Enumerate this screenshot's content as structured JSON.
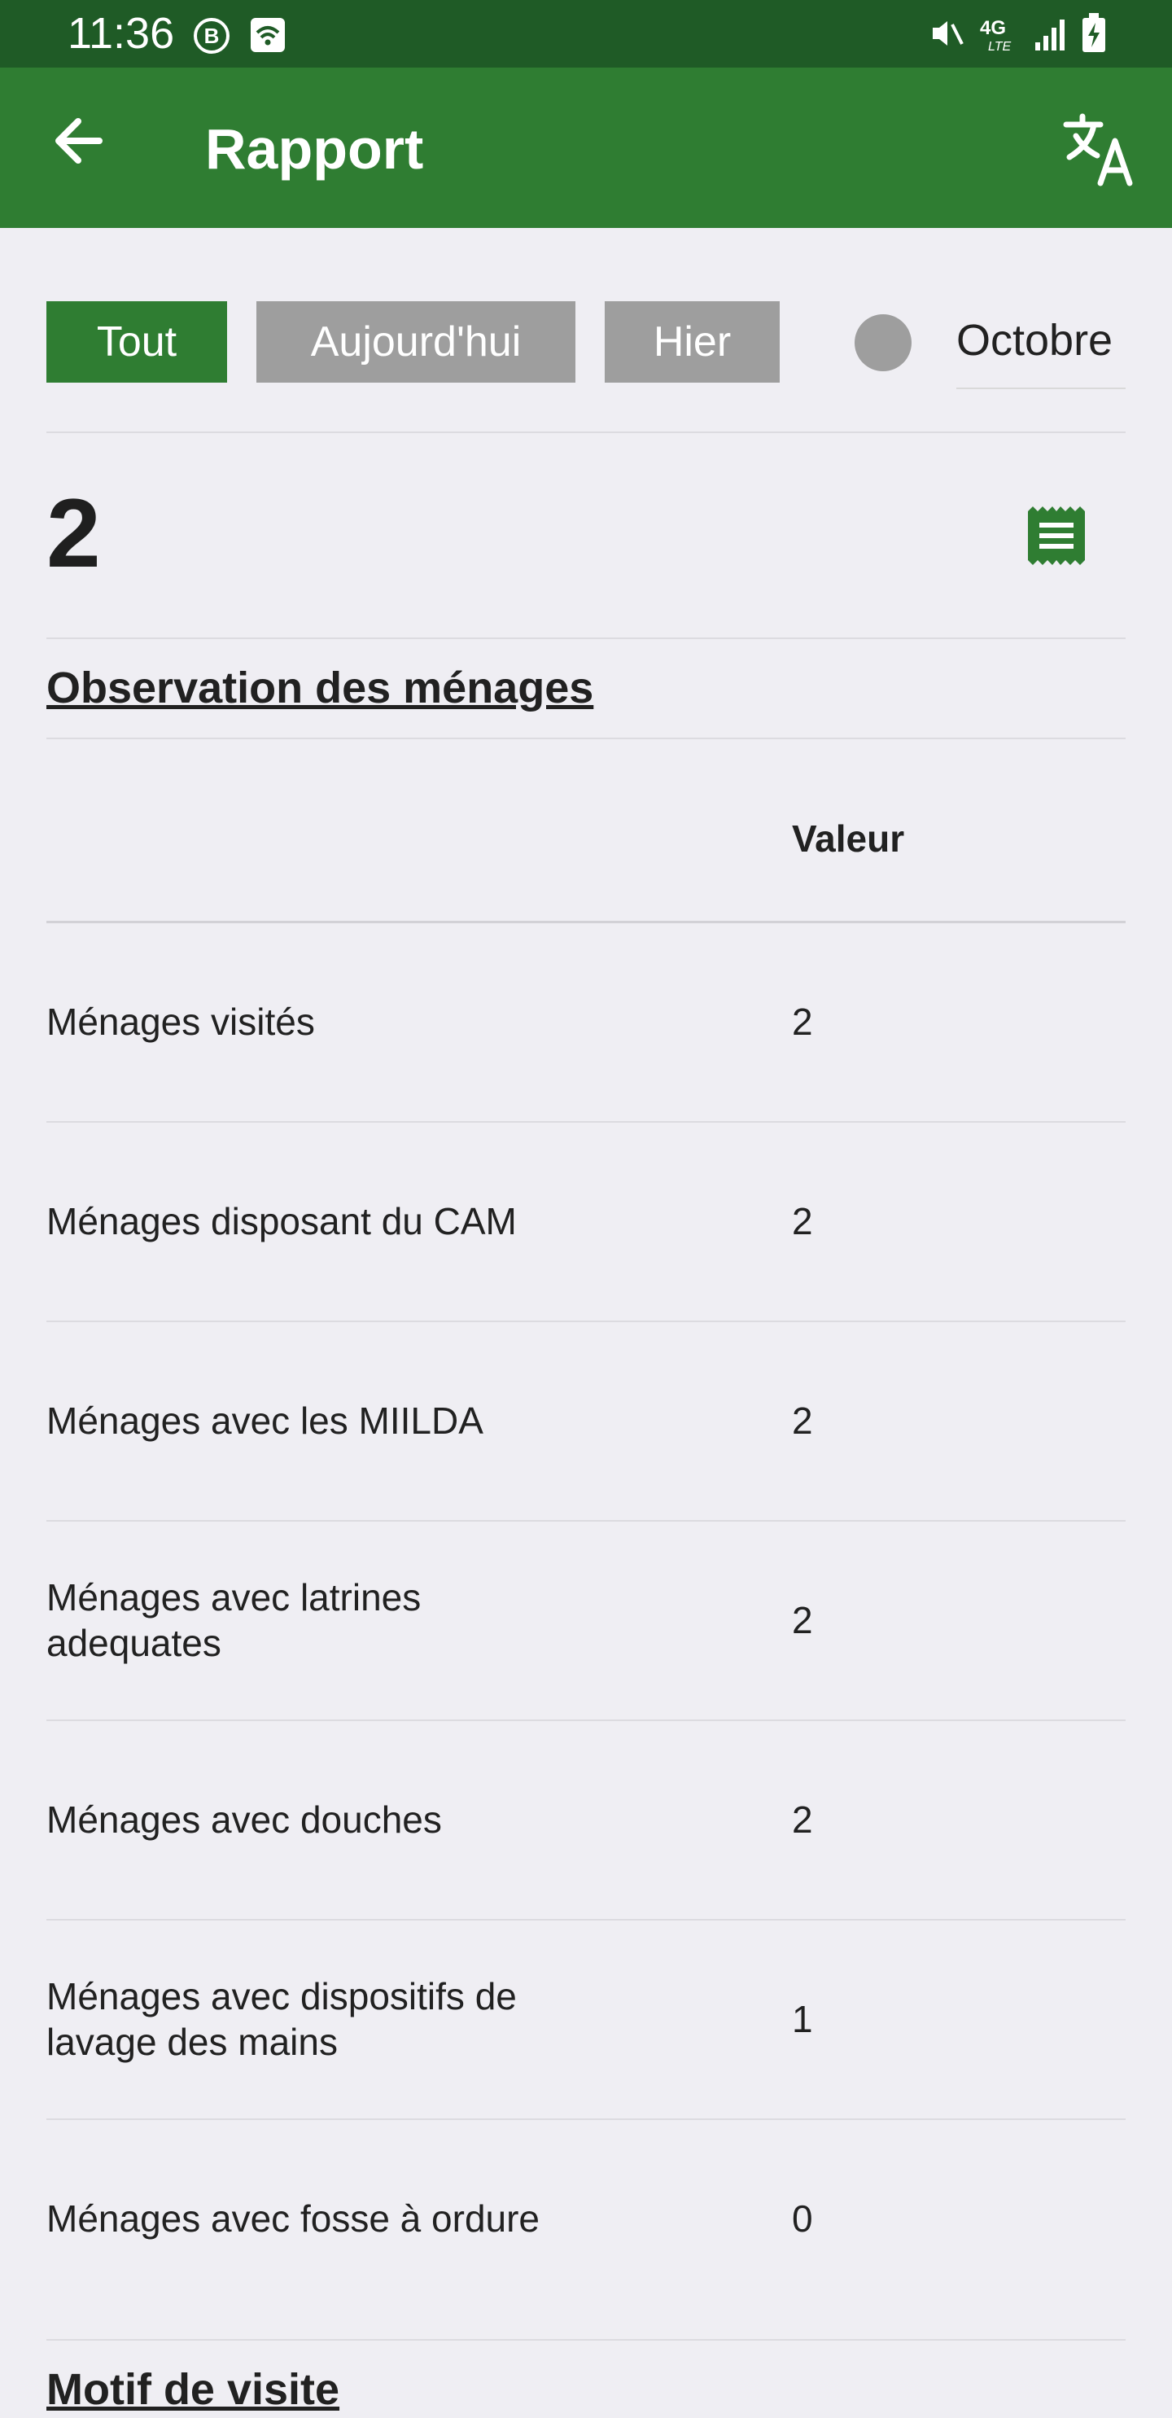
{
  "status_bar": {
    "time": "11:36",
    "icons": [
      "b-badge-icon",
      "wifi-icon",
      "mute-icon",
      "4g-lte-icon",
      "signal-icon",
      "battery-charging-icon"
    ]
  },
  "app_bar": {
    "title": "Rapport",
    "back_icon": "arrow-left-icon",
    "translate_icon": "translate-icon"
  },
  "filters": {
    "chips": [
      "Tout",
      "Aujourd'hui",
      "Hier"
    ],
    "selected_chip": "Tout",
    "month": "Octobre"
  },
  "summary": {
    "count": "2",
    "icon": "receipt-icon"
  },
  "colors": {
    "primary": "#2f7d32",
    "status_bar": "#1f5b26",
    "chip_inactive": "#9e9e9e",
    "background": "#efeef3"
  },
  "section_observation": {
    "title": "Observation des ménages",
    "column_header": "Valeur",
    "rows": [
      {
        "label": "Ménages visités",
        "value": "2"
      },
      {
        "label": "Ménages disposant du CAM",
        "value": "2"
      },
      {
        "label": "Ménages avec les MIILDA",
        "value": "2"
      },
      {
        "label": "Ménages avec latrines adequates",
        "value": "2"
      },
      {
        "label": "Ménages avec douches",
        "value": "2"
      },
      {
        "label": "Ménages avec dispositifs de lavage des mains",
        "value": "1"
      },
      {
        "label": "Ménages avec fosse à ordure",
        "value": "0"
      }
    ]
  },
  "section_motif": {
    "title": "Motif de visite"
  }
}
